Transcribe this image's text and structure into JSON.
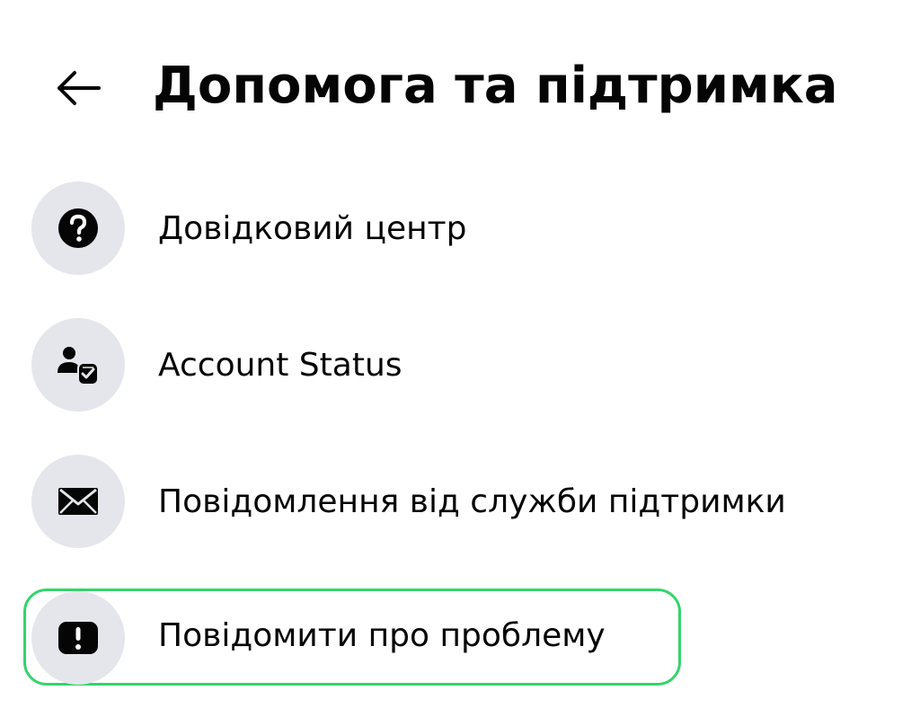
{
  "header": {
    "back_icon": "arrow-left-icon",
    "title": "Допомога та підтримка"
  },
  "menu": {
    "items": [
      {
        "label": "Довідковий центр",
        "icon": "question-circle-icon",
        "selected": false
      },
      {
        "label": "Account Status",
        "icon": "account-status-icon",
        "selected": false
      },
      {
        "label": "Повідомлення від служби підтримки",
        "icon": "envelope-icon",
        "selected": false
      },
      {
        "label": "Повідомити про проблему",
        "icon": "exclamation-badge-icon",
        "selected": true
      }
    ]
  },
  "colors": {
    "icon_bg": "#e4e6eb",
    "text": "#050505",
    "selection_outline": "#34d46b"
  }
}
